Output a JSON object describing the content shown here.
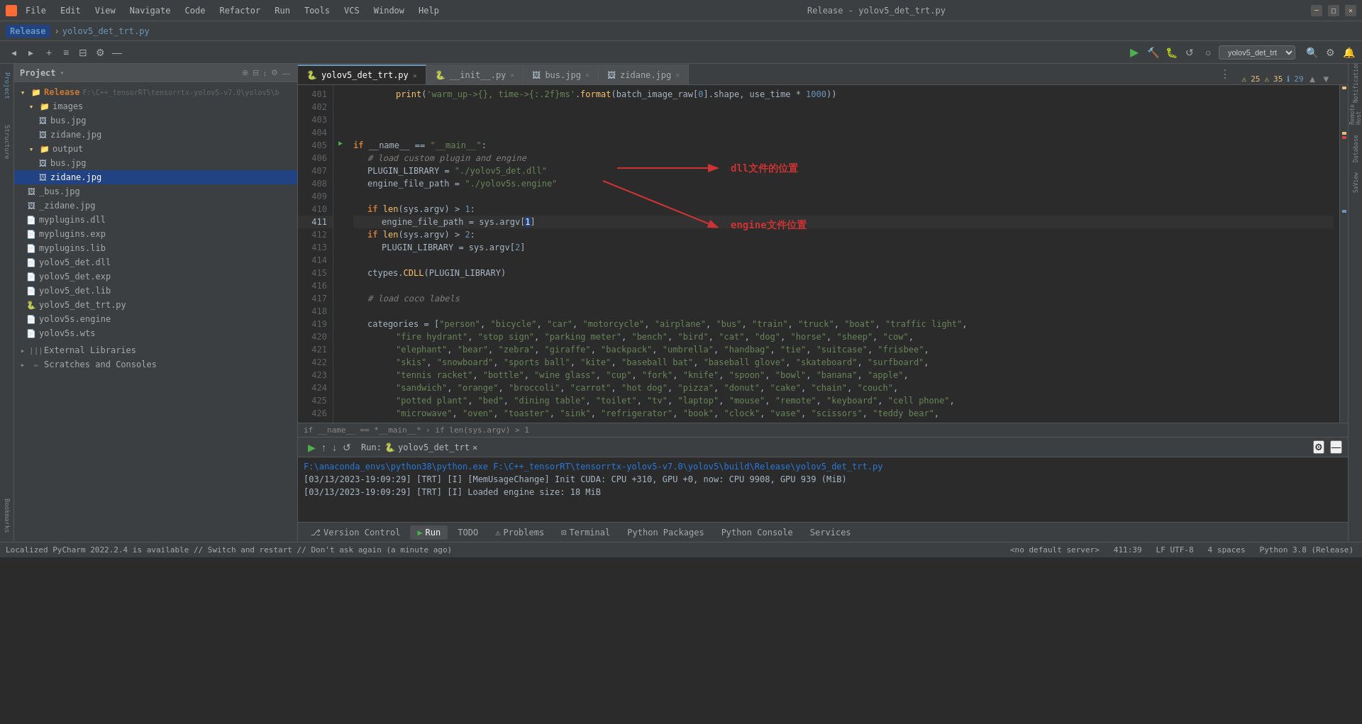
{
  "app": {
    "title": "Release - yolov5_det_trt.py",
    "icon": "pycharm"
  },
  "titlebar": {
    "menu_items": [
      "File",
      "Edit",
      "View",
      "Navigate",
      "Code",
      "Refactor",
      "Run",
      "Tools",
      "VCS",
      "Window",
      "Help"
    ],
    "window_title": "Release - yolov5_det_trt.py"
  },
  "breadcrumb": {
    "release_label": "Release",
    "separator": "›",
    "file": "yolov5_det_trt.py"
  },
  "toolbar": {
    "run_config": "yolov5_det_trt"
  },
  "project": {
    "title": "Project",
    "root": "Release",
    "root_path": "F:\\C++_tensorRT\\tensorrtx-yolov5-v7.0\\yolov5\\b",
    "items": [
      {
        "id": "release-root",
        "label": "Release",
        "type": "folder",
        "expanded": true,
        "level": 0
      },
      {
        "id": "images-folder",
        "label": "images",
        "type": "folder",
        "expanded": true,
        "level": 1
      },
      {
        "id": "bus-img",
        "label": "bus.jpg",
        "type": "image",
        "level": 2
      },
      {
        "id": "zidane-img",
        "label": "zidane.jpg",
        "type": "image",
        "level": 2
      },
      {
        "id": "output-folder",
        "label": "output",
        "type": "folder",
        "expanded": true,
        "level": 1
      },
      {
        "id": "bus-out",
        "label": "bus.jpg",
        "type": "image",
        "level": 2
      },
      {
        "id": "zidane-out",
        "label": "zidane.jpg",
        "type": "image",
        "level": 2,
        "selected": true
      },
      {
        "id": "_bus",
        "label": "_bus.jpg",
        "type": "image",
        "level": 1
      },
      {
        "id": "_zidane",
        "label": "_zidane.jpg",
        "type": "image",
        "level": 1
      },
      {
        "id": "myplugins-dll",
        "label": "myplugins.dll",
        "type": "dll",
        "level": 1
      },
      {
        "id": "myplugins-exp",
        "label": "myplugins.exp",
        "type": "exp",
        "level": 1
      },
      {
        "id": "myplugins-lib",
        "label": "myplugins.lib",
        "type": "lib",
        "level": 1
      },
      {
        "id": "yolov5-det-dll",
        "label": "yolov5_det.dll",
        "type": "dll",
        "level": 1
      },
      {
        "id": "yolov5-det-exp",
        "label": "yolov5_det.exp",
        "type": "exp",
        "level": 1
      },
      {
        "id": "yolov5-det-lib",
        "label": "yolov5_det.lib",
        "type": "lib",
        "level": 1
      },
      {
        "id": "yolov5-det-trt-py",
        "label": "yolov5_det_trt.py",
        "type": "python",
        "level": 1
      },
      {
        "id": "yolov5s-engine",
        "label": "yolov5s.engine",
        "type": "engine",
        "level": 1
      },
      {
        "id": "yolov5s-wts",
        "label": "yolov5s.wts",
        "type": "wts",
        "level": 1
      }
    ],
    "external_libraries": "External Libraries",
    "scratches": "Scratches and Consoles"
  },
  "tabs": [
    {
      "id": "yolov5-trt",
      "label": "yolov5_det_trt.py",
      "active": true
    },
    {
      "id": "init",
      "label": "__init__.py"
    },
    {
      "id": "bus",
      "label": "bus.jpg"
    },
    {
      "id": "zidane",
      "label": "zidane.jpg"
    }
  ],
  "editor": {
    "lines": [
      {
        "num": 401,
        "content": "        print('warm_up->{}, time->{}ms'.format(batch_image_raw[0].shape, use_time * 1000))",
        "type": "code"
      },
      {
        "num": 402,
        "content": "",
        "type": "blank"
      },
      {
        "num": 403,
        "content": "",
        "type": "blank"
      },
      {
        "num": 404,
        "content": "",
        "type": "blank"
      },
      {
        "num": 405,
        "content": "if __name__ == \"__main__\":",
        "type": "code",
        "has_run_arrow": true
      },
      {
        "num": 406,
        "content": "    # load custom plugin and engine",
        "type": "comment"
      },
      {
        "num": 407,
        "content": "    PLUGIN_LIBRARY = \"./yolov5_det.dll\"",
        "type": "code"
      },
      {
        "num": 408,
        "content": "    engine_file_path = \"./yolov5s.engine\"",
        "type": "code"
      },
      {
        "num": 409,
        "content": "",
        "type": "blank"
      },
      {
        "num": 410,
        "content": "    if len(sys.argv) > 1:",
        "type": "code"
      },
      {
        "num": 411,
        "content": "        engine_file_path = sys.argv[1]",
        "type": "code",
        "current": true
      },
      {
        "num": 412,
        "content": "    if len(sys.argv) > 2:",
        "type": "code"
      },
      {
        "num": 413,
        "content": "        PLUGIN_LIBRARY = sys.argv[2]",
        "type": "code"
      },
      {
        "num": 414,
        "content": "",
        "type": "blank"
      },
      {
        "num": 415,
        "content": "    ctypes.CDLL(PLUGIN_LIBRARY)",
        "type": "code"
      },
      {
        "num": 416,
        "content": "",
        "type": "blank"
      },
      {
        "num": 417,
        "content": "    # load coco labels",
        "type": "comment"
      },
      {
        "num": 418,
        "content": "",
        "type": "blank"
      },
      {
        "num": 419,
        "content": "    categories = [\"person\", \"bicycle\", \"car\", \"motorcycle\", \"airplane\", \"bus\", \"train\", \"truck\", \"boat\", \"traffic light\",",
        "type": "code"
      },
      {
        "num": 420,
        "content": "                   \"fire hydrant\", \"stop sign\", \"parking meter\", \"bench\", \"bird\", \"cat\", \"dog\", \"horse\", \"sheep\", \"cow\",",
        "type": "code"
      },
      {
        "num": 421,
        "content": "                   \"elephant\", \"bear\", \"zebra\", \"giraffe\", \"backpack\", \"umbrella\", \"handbag\", \"tie\", \"suitcase\", \"frisbee\",",
        "type": "code"
      },
      {
        "num": 422,
        "content": "                   \"skis\", \"snowboard\", \"sports ball\", \"kite\", \"baseball bat\", \"baseball glove\", \"skateboard\", \"surfboard\",",
        "type": "code"
      },
      {
        "num": 423,
        "content": "                   \"tennis racket\", \"bottle\", \"wine glass\", \"cup\", \"fork\", \"knife\", \"spoon\", \"bowl\", \"banana\", \"apple\",",
        "type": "code"
      },
      {
        "num": 424,
        "content": "                   \"sandwich\", \"orange\", \"broccoli\", \"carrot\", \"hot dog\", \"pizza\", \"donut\", \"cake\", \"chain\", \"couch\",",
        "type": "code"
      },
      {
        "num": 425,
        "content": "                   \"potted plant\", \"bed\", \"dining table\", \"toilet\", \"tv\", \"laptop\", \"mouse\", \"remote\", \"keyboard\", \"cell phone\",",
        "type": "code"
      },
      {
        "num": 426,
        "content": "                   \"microwave\", \"oven\", \"toaster\", \"sink\", \"refrigerator\", \"book\", \"clock\", \"vase\", \"scissors\", \"teddy bear\",",
        "type": "code"
      }
    ],
    "current_line": 411,
    "breadcrumb": "if __name__ == *__main__* › if len(sys.argv) > 1"
  },
  "warnings": {
    "warning_count": "25",
    "error_count": "35",
    "info_count": "29"
  },
  "annotations": [
    {
      "text": "dll文件的位置",
      "arrow_from_line": 407
    },
    {
      "text": "engine文件位置",
      "arrow_from_line": 408
    }
  ],
  "run_panel": {
    "title": "Run:",
    "config": "yolov5_det_trt",
    "run_command": "F:\\anaconda_envs\\python38\\python.exe F:\\C++_tensorRT\\tensorrtx-yolov5-v7.0\\yolov5\\build\\Release\\yolov5_det_trt.py",
    "output_lines": [
      "[03/13/2023-19:09:29] [TRT] [I] [MemUsageChange] Init CUDA: CPU +310, GPU +0, now: CPU 9908, GPU 939 (MiB)",
      "[03/13/2023-19:09:29] [TRT] [I] Loaded engine size: 18 MiB"
    ]
  },
  "bottom_tabs": [
    {
      "id": "version-control",
      "label": "Version Control"
    },
    {
      "id": "run",
      "label": "Run",
      "active": true
    },
    {
      "id": "todo",
      "label": "TODO"
    },
    {
      "id": "problems",
      "label": "Problems"
    },
    {
      "id": "terminal",
      "label": "Terminal"
    },
    {
      "id": "python-packages",
      "label": "Python Packages"
    },
    {
      "id": "python-console",
      "label": "Python Console"
    },
    {
      "id": "services",
      "label": "Services"
    }
  ],
  "status_bar": {
    "left_message": "Localized PyCharm 2022.2.4 is available // Switch and restart // Don't ask again (a minute ago)",
    "server": "<no default server>",
    "position": "411:39",
    "encoding": "LF  UTF-8",
    "indent": "4 spaces",
    "python": "Python 3.8 (Release)"
  },
  "right_panels": {
    "notifications": "Notifications",
    "remote_host": "Remote Host",
    "database": "Database",
    "saview": "SaView"
  },
  "left_panels": {
    "project": "Project",
    "structure": "Structure",
    "bookmarks": "Bookmarks"
  }
}
